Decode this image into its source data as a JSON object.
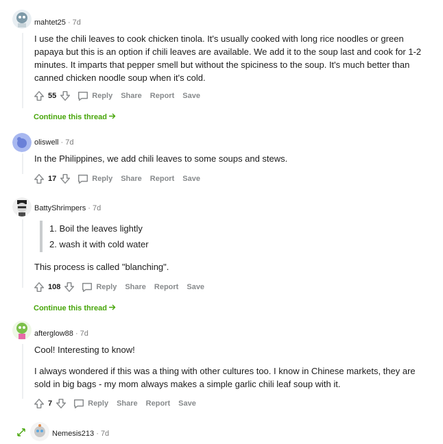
{
  "colors": {
    "continue": "#46a508",
    "muted": "#878a8c",
    "text": "#1c1c1c"
  },
  "actions": {
    "reply": "Reply",
    "share": "Share",
    "report": "Report",
    "save": "Save",
    "continue_thread": "Continue this thread"
  },
  "comments": [
    {
      "user": "mahtet25",
      "sep": "·",
      "age": "7d",
      "text": "I use the chili leaves to cook chicken tinola. It's usually cooked with long rice noodles or green papaya but this is an option if chili leaves are available. We add it to the soup last and cook for 1-2 minutes. It imparts that pepper smell but without the spiciness to the soup. It's much better than canned chicken noodle soup when it's cold.",
      "votes": "55"
    },
    {
      "user": "oliswell",
      "sep": "·",
      "age": "7d",
      "text": "In the Philippines, we add chili leaves to some soups and stews.",
      "votes": "17"
    },
    {
      "user": "BattyShrimpers",
      "sep": "·",
      "age": "7d",
      "list": [
        "Boil the leaves lightly",
        "wash it with cold water"
      ],
      "text": "This process is called \"blanching\".",
      "votes": "108"
    },
    {
      "user": "afterglow88",
      "sep": "·",
      "age": "7d",
      "text": "Cool! Interesting to know!",
      "text2": "I always wondered if this was a thing with other cultures too. I know in Chinese markets, they are sold in big bags - my mom always makes a simple garlic chili leaf soup with it.",
      "votes": "7"
    },
    {
      "user": "Nemesis213",
      "sep": "·",
      "age": "7d"
    }
  ]
}
